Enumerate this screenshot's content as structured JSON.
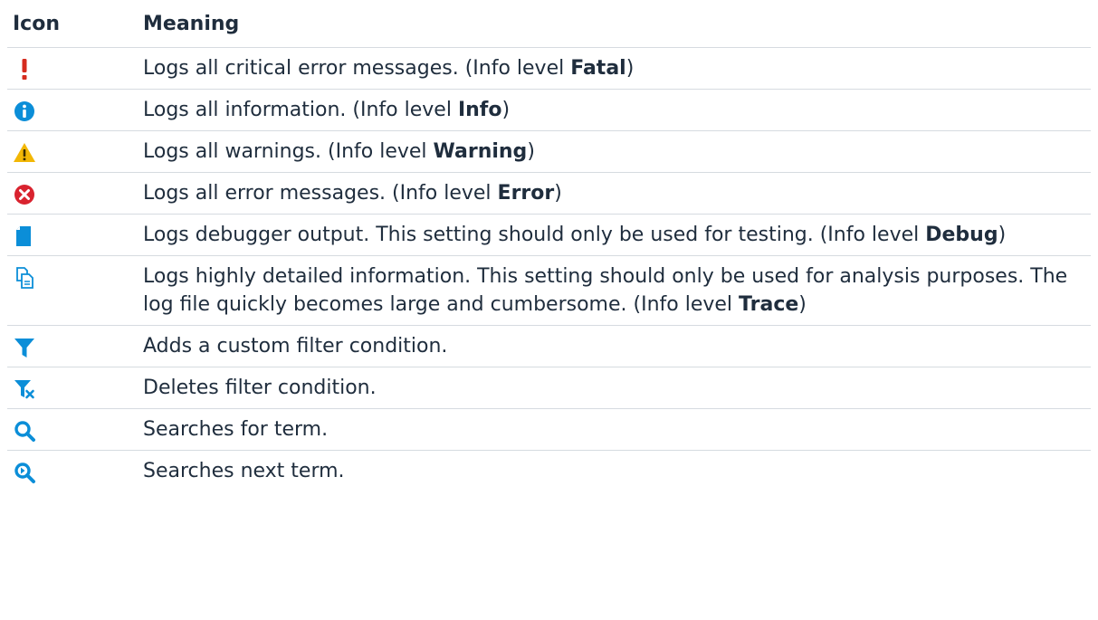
{
  "header": {
    "icon": "Icon",
    "meaning": "Meaning"
  },
  "rows": [
    {
      "icon": "fatal-icon",
      "pre": "Logs all critical error messages. (Info level ",
      "bold": "Fatal",
      "post": ")"
    },
    {
      "icon": "info-icon",
      "pre": "Logs all information. (Info level ",
      "bold": "Info",
      "post": ")"
    },
    {
      "icon": "warning-icon",
      "pre": "Logs all warnings. (Info level ",
      "bold": "Warning",
      "post": ")"
    },
    {
      "icon": "error-icon",
      "pre": "Logs all error messages. (Info level ",
      "bold": "Error",
      "post": ")"
    },
    {
      "icon": "debug-icon",
      "pre": "Logs debugger output. This setting should only be used for testing. (Info level ",
      "bold": "Debug",
      "post": ")"
    },
    {
      "icon": "trace-icon",
      "pre": "Logs highly detailed information. This setting should only be used for analysis purposes. The log file quickly becomes large and cumbersome. (Info level ",
      "bold": "Trace",
      "post": ")"
    },
    {
      "icon": "add-filter-icon",
      "pre": "Adds a custom filter condition.",
      "bold": "",
      "post": ""
    },
    {
      "icon": "delete-filter-icon",
      "pre": "Deletes filter condition.",
      "bold": "",
      "post": ""
    },
    {
      "icon": "search-icon",
      "pre": "Searches for term.",
      "bold": "",
      "post": ""
    },
    {
      "icon": "search-next-icon",
      "pre": "Searches next term.",
      "bold": "",
      "post": ""
    }
  ],
  "colors": {
    "text": "#1f2d3d",
    "fatal": "#d52b1e",
    "info": "#0b8ed8",
    "warning": "#f2b705",
    "error": "#d9232f",
    "blue": "#0b8ed8"
  }
}
